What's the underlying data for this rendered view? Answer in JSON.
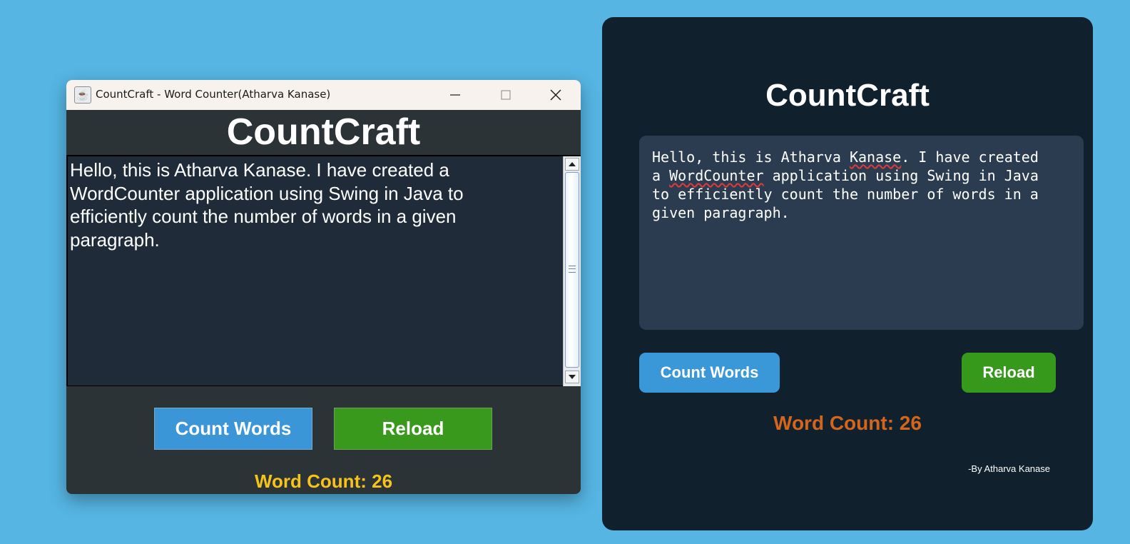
{
  "swing_window": {
    "title": "CountCraft - Word Counter(Atharva Kanase)",
    "header": "CountCraft",
    "text": "Hello, this is Atharva Kanase. I have created a\nWordCounter application using Swing in Java to\nefficiently count the number of words in a given\nparagraph.",
    "count_button": "Count Words",
    "reload_button": "Reload",
    "word_count": "Word Count: 26",
    "colors": {
      "count_button": "#3b96d8",
      "reload_button": "#39991c",
      "word_count": "#f5c31a"
    }
  },
  "web_app": {
    "title": "CountCraft",
    "text_parts": [
      "Hello, this is Atharva ",
      "Kanase",
      ". I have created\na ",
      "WordCounter",
      " application using Swing in Java\nto efficiently count the number of words in a\ngiven paragraph."
    ],
    "count_button": "Count Words",
    "reload_button": "Reload",
    "word_count": "Word Count: 26",
    "byline": "-By Atharva Kanase",
    "colors": {
      "count_button": "#3a97d8",
      "reload_button": "#36991c",
      "word_count": "#d4651c"
    }
  }
}
